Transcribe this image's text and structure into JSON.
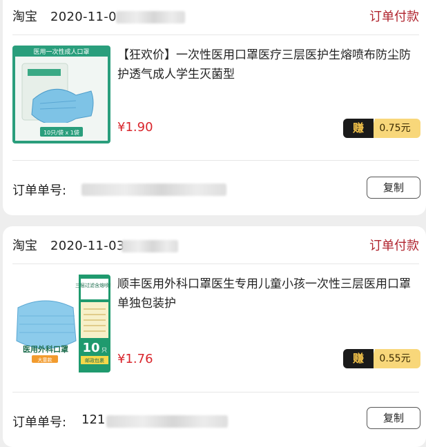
{
  "orders": [
    {
      "platform": "淘宝",
      "date": "2020-11-0",
      "status": "订单付款",
      "title": "【狂欢价】一次性医用口罩医疗三层医护生熔喷布防尘防护透气成人学生灭菌型",
      "price": "¥1.90",
      "earn_label": "赚",
      "earn_amount": "0.75元",
      "order_label": "订单单号:",
      "order_number": "",
      "copy_label": "复制",
      "thumb": {
        "header": "医用一次性成人口罩",
        "footer": "10只/袋 x 1袋"
      }
    },
    {
      "platform": "淘宝",
      "date": "2020-11-03",
      "status": "订单付款",
      "title": "顺丰医用外科口罩医生专用儿童小孩一次性三层医用口罩单独包装护",
      "price": "¥1.76",
      "earn_label": "赚",
      "earn_amount": "0.55元",
      "order_label": "订单单号:",
      "order_number": "121",
      "copy_label": "复制",
      "thumb": {
        "side_top": "三层过滤含熔喷层",
        "count": "10",
        "count_unit": "只",
        "caption": "医用外科口罩",
        "tag": "大童款",
        "side_bottom": "邮政包裹"
      }
    }
  ],
  "colors": {
    "status": "#b0242e",
    "price": "#d9252c",
    "earn_dark": "#1a1a1a",
    "earn_gold": "#f8d77a",
    "thumb_green": "#2a9e7c"
  }
}
